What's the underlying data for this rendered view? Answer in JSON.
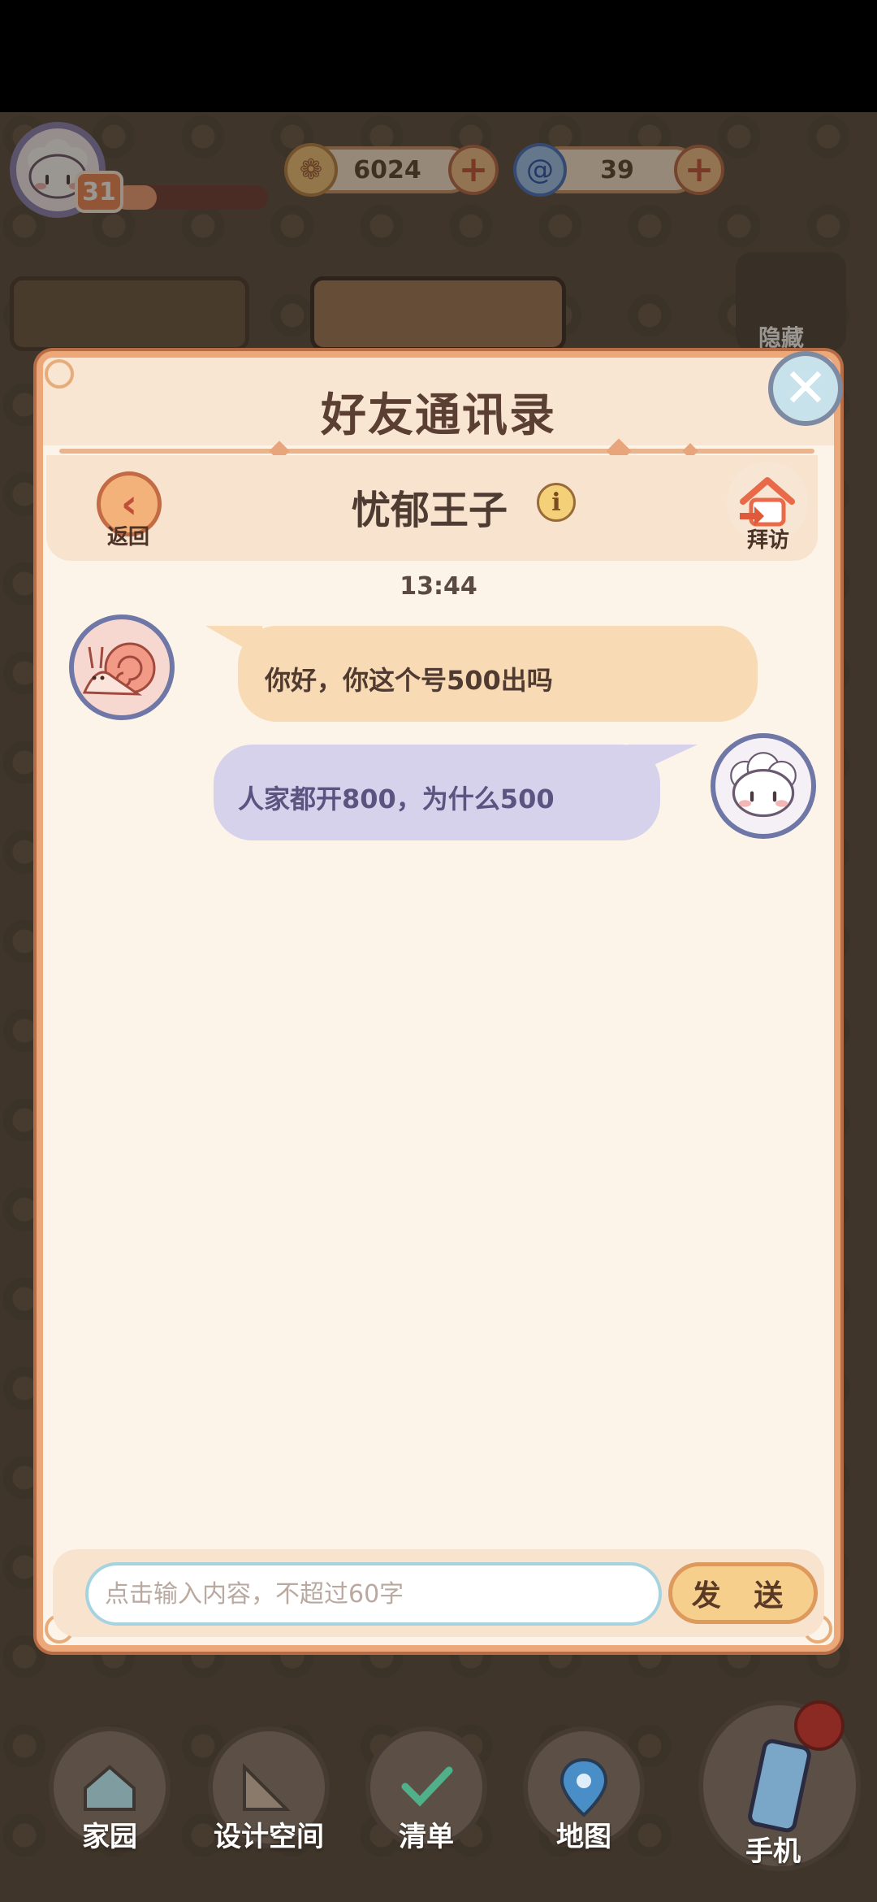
{
  "hud": {
    "level": "31",
    "xp_progress": 0.28,
    "coins": "6024",
    "gems": "39"
  },
  "dialog": {
    "title": "好友通讯录",
    "back_label": "返回",
    "contact_name": "忧郁王子",
    "visit_label": "拜访",
    "timestamp": "13:44",
    "messages": [
      {
        "from": "contact",
        "text": "你好，你这个号500出吗"
      },
      {
        "from": "me",
        "text": "人家都开800，为什么500"
      }
    ],
    "input_placeholder": "点击输入内容，不超过60字",
    "send_label": "发 送"
  },
  "bg_label": "隐藏",
  "nav": [
    {
      "label": "家园",
      "icon": "home-icon"
    },
    {
      "label": "设计空间",
      "icon": "design-icon"
    },
    {
      "label": "清单",
      "icon": "checklist-icon"
    },
    {
      "label": "地图",
      "icon": "map-pin-icon"
    },
    {
      "label": "手机",
      "icon": "phone-icon"
    }
  ],
  "colors": {
    "dialog_bg": "#fcf4e8",
    "dialog_border": "#eca879",
    "bubble_in": "#f8dab5",
    "bubble_out": "#d7d2ec"
  }
}
